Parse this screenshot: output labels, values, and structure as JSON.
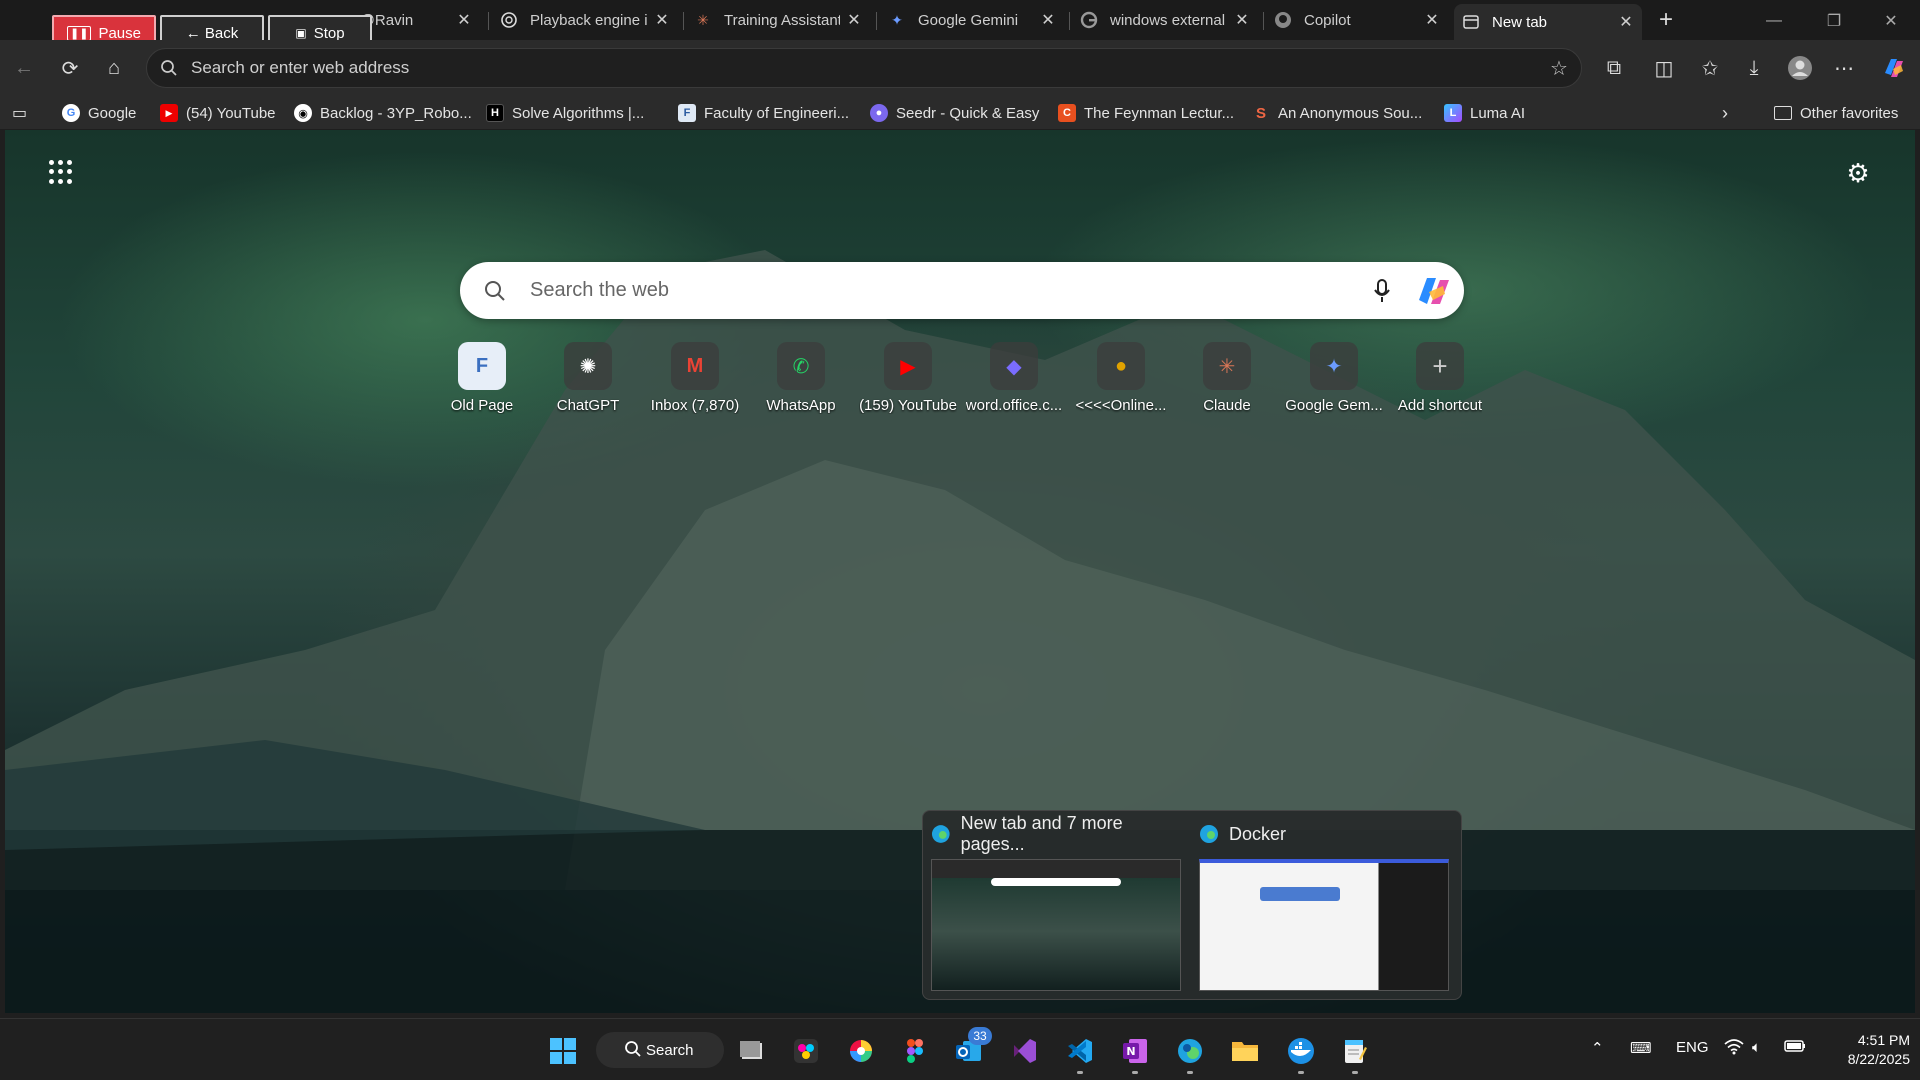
{
  "recorder": {
    "pause_label": "Pause",
    "back_label": "← Back",
    "stop_label": "Stop"
  },
  "tabs": [
    {
      "label": "g · @Ravin",
      "icon": "channel-icon"
    },
    {
      "label": "Playback engine i",
      "icon": "chatgpt-icon"
    },
    {
      "label": "Training Assistant",
      "icon": "claude-icon"
    },
    {
      "label": "Google Gemini",
      "icon": "gemini-icon"
    },
    {
      "label": "windows external",
      "icon": "google-icon"
    },
    {
      "label": "Copilot",
      "icon": "github-icon"
    },
    {
      "label": "New tab",
      "icon": "newtab-icon",
      "active": true
    }
  ],
  "address_bar": {
    "placeholder": "Search or enter web address"
  },
  "favorites": [
    {
      "label": "Google",
      "icon": "google-icon"
    },
    {
      "label": "(54) YouTube",
      "icon": "youtube-icon"
    },
    {
      "label": "Backlog - 3YP_Robo...",
      "icon": "github-icon"
    },
    {
      "label": "Solve Algorithms |...",
      "icon": "hackerrank-icon"
    },
    {
      "label": "Faculty of Engineeri...",
      "icon": "faculty-icon"
    },
    {
      "label": "Seedr - Quick & Easy",
      "icon": "seedr-icon"
    },
    {
      "label": "The Feynman Lectur...",
      "icon": "feynman-icon"
    },
    {
      "label": "An Anonymous Sou...",
      "icon": "soundcloud-icon"
    },
    {
      "label": "Luma AI",
      "icon": "luma-icon"
    }
  ],
  "other_favorites": "Other favorites",
  "newtab": {
    "search_placeholder": "Search the web",
    "shortcuts": [
      {
        "label": "Old Page",
        "icon": "old-page-icon",
        "glyph": "F"
      },
      {
        "label": "ChatGPT",
        "icon": "chatgpt-icon",
        "glyph": "✺"
      },
      {
        "label": "Inbox (7,870)",
        "icon": "gmail-icon",
        "glyph": "M"
      },
      {
        "label": "WhatsApp",
        "icon": "whatsapp-icon",
        "glyph": "✆"
      },
      {
        "label": "(159) YouTube",
        "icon": "youtube-icon",
        "glyph": "▶"
      },
      {
        "label": "word.office.c...",
        "icon": "copilot-icon",
        "glyph": "◆"
      },
      {
        "label": "<<<<Online...",
        "icon": "emblem-icon",
        "glyph": "●"
      },
      {
        "label": "Claude",
        "icon": "claude-icon",
        "glyph": "✳"
      },
      {
        "label": "Google Gem...",
        "icon": "gemini-icon",
        "glyph": "✦"
      },
      {
        "label": "Add shortcut",
        "icon": "add-icon",
        "glyph": "+"
      }
    ]
  },
  "taskbar_preview": [
    {
      "title": "New tab and 7 more pages..."
    },
    {
      "title": "Docker"
    }
  ],
  "taskbar": {
    "search_label": "Search",
    "outlook_badge": "33",
    "language": "ENG",
    "time": "4:51 PM",
    "date": "8/22/2025"
  },
  "colors": {
    "accent": "#0078d4",
    "pause": "#d9333c"
  }
}
